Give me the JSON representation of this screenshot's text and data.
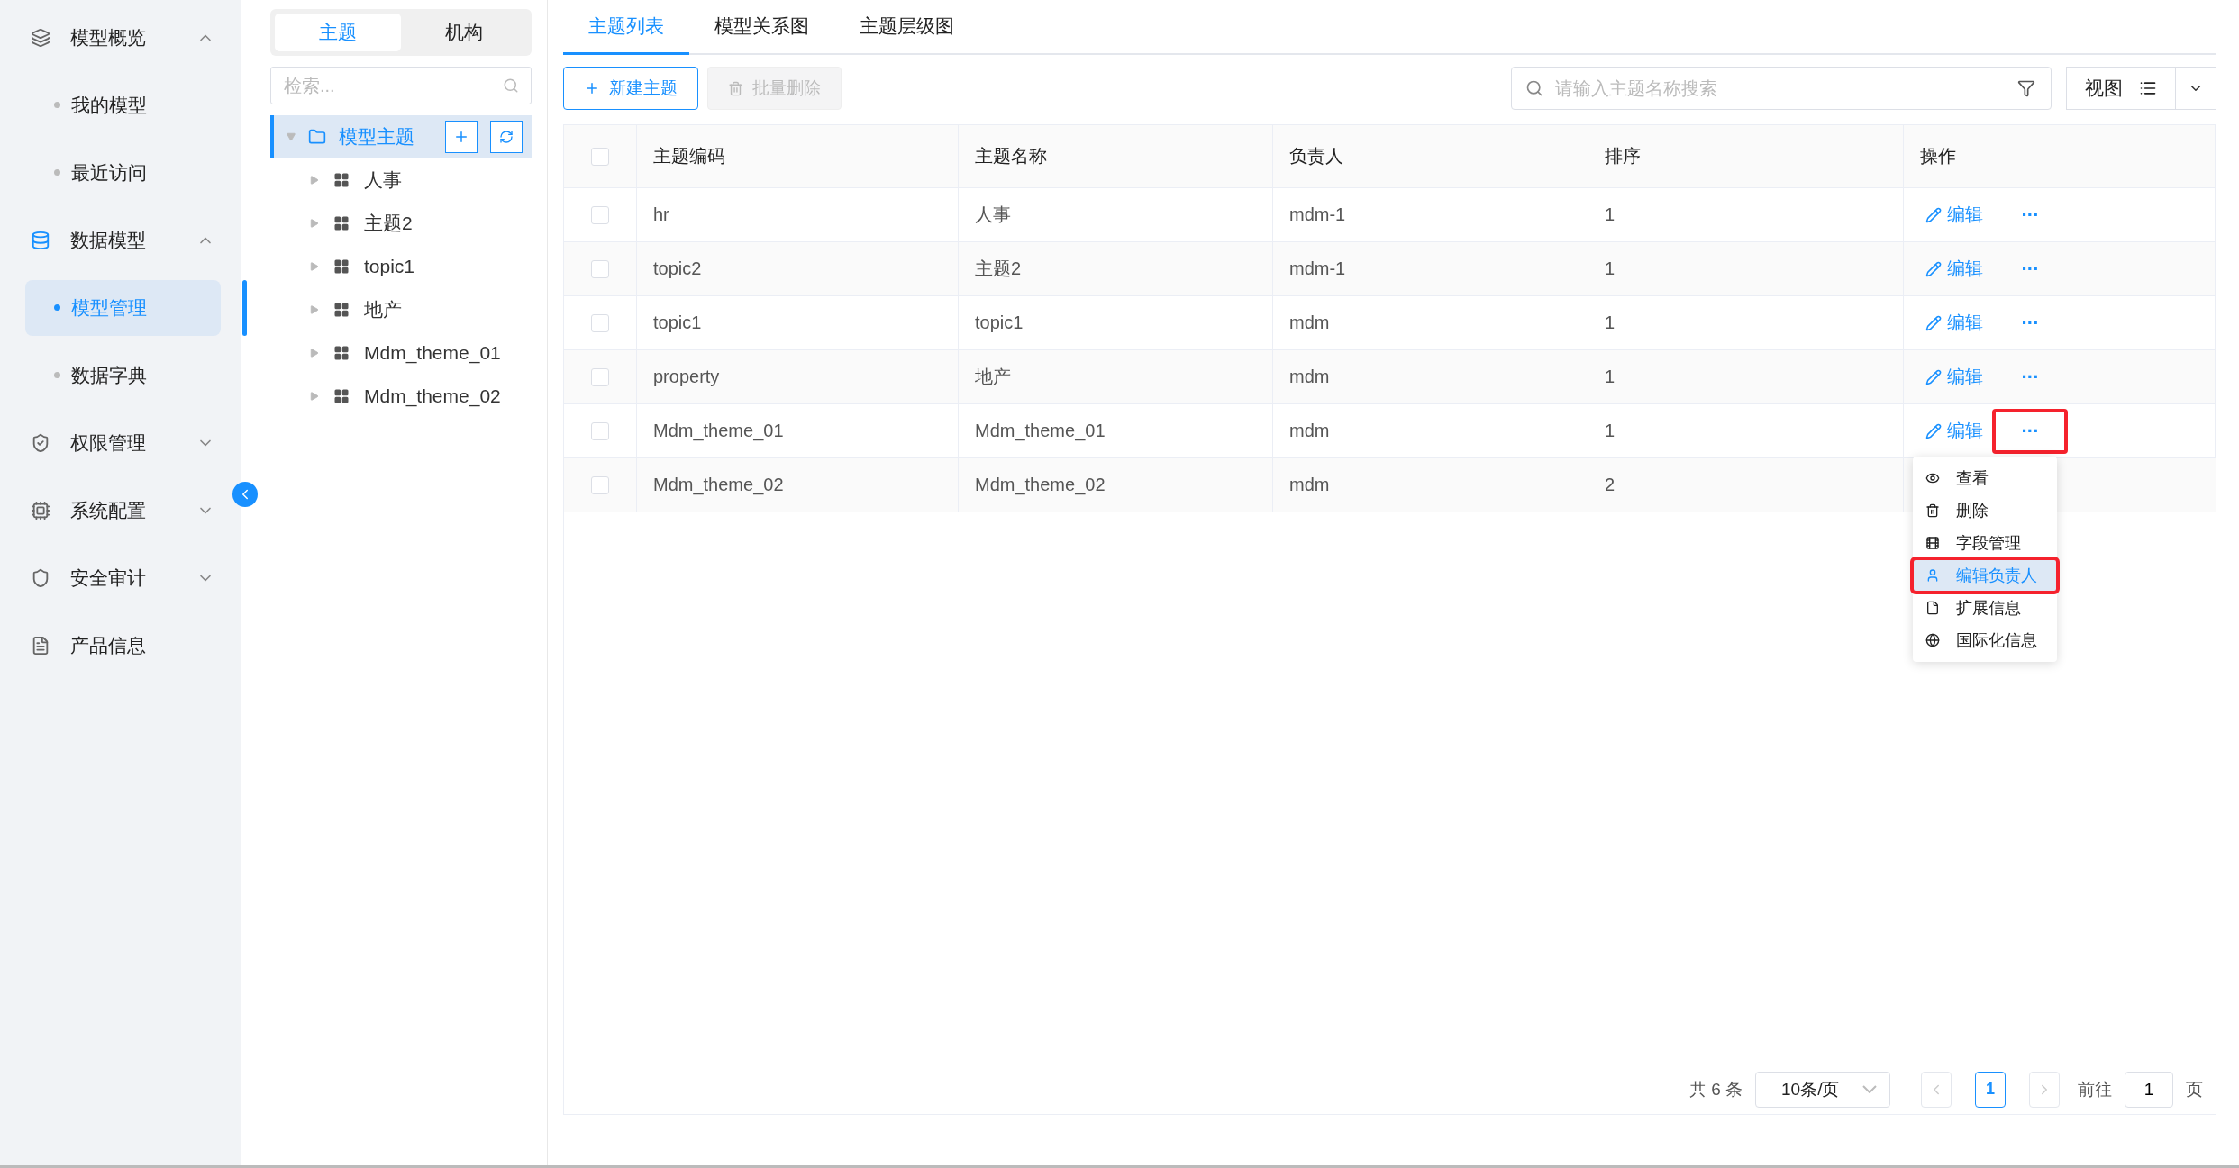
{
  "sidebar": {
    "groups": [
      {
        "kind": "group",
        "label": "模型概览",
        "expanded": true,
        "children": [
          {
            "label": "我的模型",
            "selected": false
          },
          {
            "label": "最近访问",
            "selected": false
          }
        ]
      },
      {
        "kind": "group",
        "label": "数据模型",
        "expanded": true,
        "children": [
          {
            "label": "模型管理",
            "selected": true
          },
          {
            "label": "数据字典",
            "selected": false
          }
        ]
      },
      {
        "kind": "group",
        "label": "权限管理",
        "expanded": false
      },
      {
        "kind": "group",
        "label": "系统配置",
        "expanded": false
      },
      {
        "kind": "group",
        "label": "安全审计",
        "expanded": false
      },
      {
        "kind": "link",
        "label": "产品信息"
      }
    ]
  },
  "tree_panel": {
    "tabs": [
      {
        "label": "主题",
        "selected": true
      },
      {
        "label": "机构",
        "selected": false
      }
    ],
    "search": {
      "placeholder": "检索..."
    },
    "tree": {
      "label": "模型主题",
      "expanded": true,
      "selected": true,
      "children": [
        {
          "label": "人事",
          "expanded": false
        },
        {
          "label": "主题2",
          "expanded": false
        },
        {
          "label": "topic1",
          "expanded": false
        },
        {
          "label": "地产",
          "expanded": false
        },
        {
          "label": "Mdm_theme_01",
          "expanded": false
        },
        {
          "label": "Mdm_theme_02",
          "expanded": false
        }
      ]
    }
  },
  "tabs": [
    {
      "label": "主题列表",
      "selected": true
    },
    {
      "label": "模型关系图",
      "selected": false
    },
    {
      "label": "主题层级图",
      "selected": false
    }
  ],
  "toolbar": {
    "new_button": {
      "label": "新建主题",
      "disabled": false
    },
    "delete_button": {
      "label": "批量删除",
      "disabled": true
    },
    "search": {
      "placeholder": "请输入主题名称搜索"
    },
    "view_button": {
      "label": "视图"
    }
  },
  "table": {
    "all_checked": false,
    "columns": [
      "主题编码",
      "主题名称",
      "负责人",
      "排序",
      "操作"
    ],
    "rows": [
      {
        "checked": false,
        "cells": [
          "hr",
          "人事",
          "mdm-1",
          "1"
        ],
        "edit": "编辑",
        "more": "···",
        "more_highlighted": false
      },
      {
        "checked": false,
        "cells": [
          "topic2",
          "主题2",
          "mdm-1",
          "1"
        ],
        "edit": "编辑",
        "more": "···",
        "more_highlighted": false
      },
      {
        "checked": false,
        "cells": [
          "topic1",
          "topic1",
          "mdm",
          "1"
        ],
        "edit": "编辑",
        "more": "···",
        "more_highlighted": false
      },
      {
        "checked": false,
        "cells": [
          "property",
          "地产",
          "mdm",
          "1"
        ],
        "edit": "编辑",
        "more": "···",
        "more_highlighted": false
      },
      {
        "checked": false,
        "cells": [
          "Mdm_theme_01",
          "Mdm_theme_01",
          "mdm",
          "1"
        ],
        "edit": "编辑",
        "more": "···",
        "more_highlighted": true
      },
      {
        "checked": false,
        "cells": [
          "Mdm_theme_02",
          "Mdm_theme_02",
          "mdm",
          "2"
        ]
      }
    ]
  },
  "action_menu": [
    {
      "label": "查看",
      "selected": false,
      "highlighted": false
    },
    {
      "label": "删除",
      "selected": false,
      "highlighted": false
    },
    {
      "label": "字段管理",
      "selected": false,
      "highlighted": false
    },
    {
      "label": "编辑负责人",
      "selected": true,
      "highlighted": true
    },
    {
      "label": "扩展信息",
      "selected": false,
      "highlighted": false
    },
    {
      "label": "国际化信息",
      "selected": false,
      "highlighted": false
    }
  ],
  "pagination": {
    "total": "共 6 条",
    "page_size": "10条/页",
    "pages": [
      {
        "label": "1",
        "selected": true
      }
    ],
    "goto_label": "前往",
    "goto_value": "1",
    "page_suffix": "页"
  }
}
